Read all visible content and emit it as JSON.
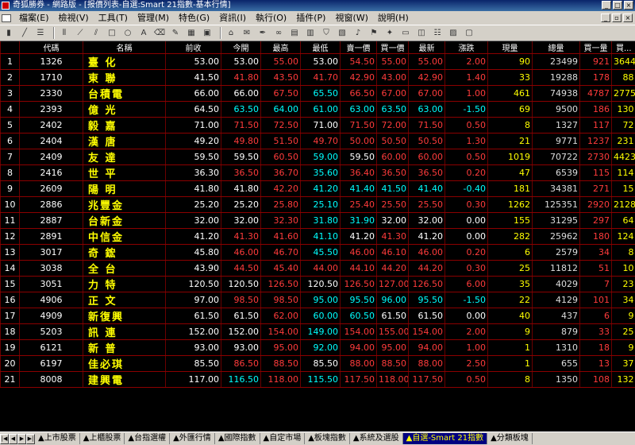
{
  "window": {
    "title": "奇狐勝券 - 網路版 - [报價列表-自選:Smart 21指數-基本行情]"
  },
  "menu": [
    "檔案(E)",
    "檢視(V)",
    "工具(T)",
    "管理(M)",
    "特色(G)",
    "資訊(I)",
    "執行(O)",
    "插件(P)",
    "視窗(W)",
    "說明(H)"
  ],
  "columns": [
    "",
    "代碼",
    "名稱",
    "前收",
    "今開",
    "最高",
    "最低",
    "賣一價",
    "買一價",
    "最新",
    "漲跌",
    "現量",
    "總量",
    "買一量",
    "買..."
  ],
  "rows": [
    {
      "idx": "1",
      "code": "1326",
      "name": "臺 化",
      "prev": "53.00",
      "open": "53.00",
      "high": "55.00",
      "low": "53.00",
      "sell": "54.50",
      "buy": "55.00",
      "last": "55.00",
      "chg": "2.00",
      "vol": "90",
      "total": "23499",
      "bq": "921",
      "b2": "3644"
    },
    {
      "idx": "2",
      "code": "1710",
      "name": "東 聯",
      "prev": "41.50",
      "open": "41.80",
      "high": "43.50",
      "low": "41.70",
      "sell": "42.90",
      "buy": "43.00",
      "last": "42.90",
      "chg": "1.40",
      "vol": "33",
      "total": "19288",
      "bq": "178",
      "b2": "88"
    },
    {
      "idx": "3",
      "code": "2330",
      "name": "台積電",
      "prev": "66.00",
      "open": "66.00",
      "high": "67.50",
      "low": "65.50",
      "sell": "66.50",
      "buy": "67.00",
      "last": "67.00",
      "chg": "1.00",
      "vol": "461",
      "total": "74938",
      "bq": "4787",
      "b2": "2775"
    },
    {
      "idx": "4",
      "code": "2393",
      "name": "億 光",
      "prev": "64.50",
      "open": "63.50",
      "high": "64.00",
      "low": "61.00",
      "sell": "63.00",
      "buy": "63.50",
      "last": "63.00",
      "chg": "-1.50",
      "vol": "69",
      "total": "9500",
      "bq": "186",
      "b2": "130"
    },
    {
      "idx": "5",
      "code": "2402",
      "name": "毅 嘉",
      "prev": "71.00",
      "open": "71.50",
      "high": "72.50",
      "low": "71.00",
      "sell": "71.50",
      "buy": "72.00",
      "last": "71.50",
      "chg": "0.50",
      "vol": "8",
      "total": "1327",
      "bq": "117",
      "b2": "72"
    },
    {
      "idx": "6",
      "code": "2404",
      "name": "漢 唐",
      "prev": "49.20",
      "open": "49.80",
      "high": "51.50",
      "low": "49.70",
      "sell": "50.00",
      "buy": "50.50",
      "last": "50.50",
      "chg": "1.30",
      "vol": "21",
      "total": "9771",
      "bq": "1237",
      "b2": "231"
    },
    {
      "idx": "7",
      "code": "2409",
      "name": "友 達",
      "prev": "59.50",
      "open": "59.50",
      "high": "60.50",
      "low": "59.00",
      "sell": "59.50",
      "buy": "60.00",
      "last": "60.00",
      "chg": "0.50",
      "vol": "1019",
      "total": "70722",
      "bq": "2730",
      "b2": "4423"
    },
    {
      "idx": "8",
      "code": "2416",
      "name": "世 平",
      "prev": "36.30",
      "open": "36.50",
      "high": "36.70",
      "low": "35.60",
      "sell": "36.40",
      "buy": "36.50",
      "last": "36.50",
      "chg": "0.20",
      "vol": "47",
      "total": "6539",
      "bq": "115",
      "b2": "114"
    },
    {
      "idx": "9",
      "code": "2609",
      "name": "陽 明",
      "prev": "41.80",
      "open": "41.80",
      "high": "42.20",
      "low": "41.20",
      "sell": "41.40",
      "buy": "41.50",
      "last": "41.40",
      "chg": "-0.40",
      "vol": "181",
      "total": "34381",
      "bq": "271",
      "b2": "15"
    },
    {
      "idx": "10",
      "code": "2886",
      "name": "兆豐金",
      "prev": "25.20",
      "open": "25.20",
      "high": "25.80",
      "low": "25.10",
      "sell": "25.40",
      "buy": "25.50",
      "last": "25.50",
      "chg": "0.30",
      "vol": "1262",
      "total": "125351",
      "bq": "2920",
      "b2": "2128"
    },
    {
      "idx": "11",
      "code": "2887",
      "name": "台新金",
      "prev": "32.00",
      "open": "32.00",
      "high": "32.30",
      "low": "31.80",
      "sell": "31.90",
      "buy": "32.00",
      "last": "32.00",
      "chg": "0.00",
      "vol": "155",
      "total": "31295",
      "bq": "297",
      "b2": "64"
    },
    {
      "idx": "12",
      "code": "2891",
      "name": "中信金",
      "prev": "41.20",
      "open": "41.30",
      "high": "41.60",
      "low": "41.10",
      "sell": "41.20",
      "buy": "41.30",
      "last": "41.20",
      "chg": "0.00",
      "vol": "282",
      "total": "25962",
      "bq": "180",
      "b2": "124"
    },
    {
      "idx": "13",
      "code": "3017",
      "name": "奇 鋐",
      "prev": "45.80",
      "open": "46.00",
      "high": "46.70",
      "low": "45.50",
      "sell": "46.00",
      "buy": "46.10",
      "last": "46.00",
      "chg": "0.20",
      "vol": "6",
      "total": "2579",
      "bq": "34",
      "b2": "8"
    },
    {
      "idx": "14",
      "code": "3038",
      "name": "全 台",
      "prev": "43.90",
      "open": "44.50",
      "high": "45.40",
      "low": "44.00",
      "sell": "44.10",
      "buy": "44.20",
      "last": "44.20",
      "chg": "0.30",
      "vol": "25",
      "total": "11812",
      "bq": "51",
      "b2": "10"
    },
    {
      "idx": "15",
      "code": "3051",
      "name": "力 特",
      "prev": "120.50",
      "open": "120.50",
      "high": "126.50",
      "low": "120.50",
      "sell": "126.50",
      "buy": "127.00",
      "last": "126.50",
      "chg": "6.00",
      "vol": "35",
      "total": "4029",
      "bq": "7",
      "b2": "23"
    },
    {
      "idx": "16",
      "code": "4906",
      "name": "正 文",
      "prev": "97.00",
      "open": "98.50",
      "high": "98.50",
      "low": "95.00",
      "sell": "95.50",
      "buy": "96.00",
      "last": "95.50",
      "chg": "-1.50",
      "vol": "22",
      "total": "4129",
      "bq": "101",
      "b2": "34"
    },
    {
      "idx": "17",
      "code": "4909",
      "name": "新復興",
      "prev": "61.50",
      "open": "61.50",
      "high": "62.00",
      "low": "60.00",
      "sell": "60.50",
      "buy": "61.50",
      "last": "61.50",
      "chg": "0.00",
      "vol": "40",
      "total": "437",
      "bq": "6",
      "b2": "9"
    },
    {
      "idx": "18",
      "code": "5203",
      "name": "訊 連",
      "prev": "152.00",
      "open": "152.00",
      "high": "154.00",
      "low": "149.00",
      "sell": "154.00",
      "buy": "155.00",
      "last": "154.00",
      "chg": "2.00",
      "vol": "9",
      "total": "879",
      "bq": "33",
      "b2": "25"
    },
    {
      "idx": "19",
      "code": "6121",
      "name": "新 普",
      "prev": "93.00",
      "open": "93.00",
      "high": "95.00",
      "low": "92.00",
      "sell": "94.00",
      "buy": "95.00",
      "last": "94.00",
      "chg": "1.00",
      "vol": "1",
      "total": "1310",
      "bq": "18",
      "b2": "9"
    },
    {
      "idx": "20",
      "code": "6197",
      "name": "佳必琪",
      "prev": "85.50",
      "open": "86.50",
      "high": "88.50",
      "low": "85.50",
      "sell": "88.00",
      "buy": "88.50",
      "last": "88.00",
      "chg": "2.50",
      "vol": "1",
      "total": "655",
      "bq": "13",
      "b2": "37"
    },
    {
      "idx": "21",
      "code": "8008",
      "name": "建興電",
      "prev": "117.00",
      "open": "116.50",
      "high": "118.00",
      "low": "115.50",
      "sell": "117.50",
      "buy": "118.00",
      "last": "117.50",
      "chg": "0.50",
      "vol": "8",
      "total": "1350",
      "bq": "108",
      "b2": "132"
    }
  ],
  "tabs": [
    {
      "label": "▲上市股票",
      "active": false
    },
    {
      "label": "▲上櫃股票",
      "active": false
    },
    {
      "label": "▲台指選權",
      "active": false
    },
    {
      "label": "▲外匯行情",
      "active": false
    },
    {
      "label": "▲國際指數",
      "active": false
    },
    {
      "label": "▲自定市場",
      "active": false
    },
    {
      "label": "▲板塊指數",
      "active": false
    },
    {
      "label": "▲系統及選股",
      "active": false
    },
    {
      "label": "▲自選-Smart 21指數",
      "active": true
    },
    {
      "label": "▲分類板塊",
      "active": false
    }
  ],
  "colors": {
    "up": "#ff3b3b",
    "down": "#00ffff",
    "name": "#ffff00",
    "grid": "#8b0000"
  }
}
